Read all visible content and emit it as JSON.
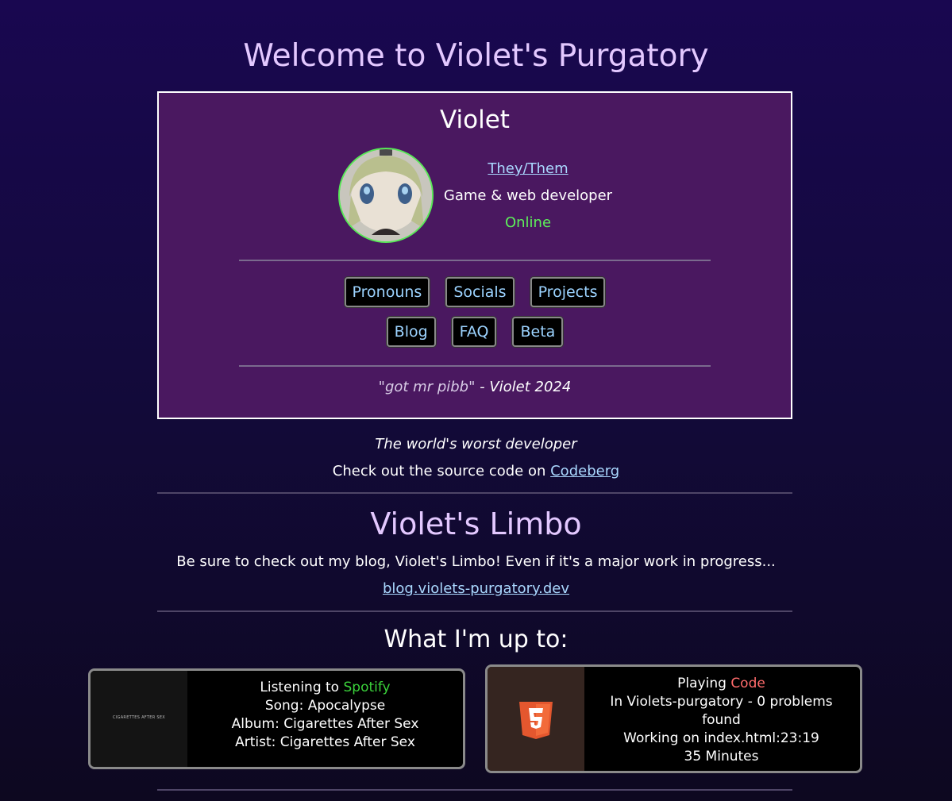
{
  "header": {
    "title": "Welcome to Violet's Purgatory"
  },
  "profile": {
    "name": "Violet",
    "pronouns": "They/Them",
    "role": "Game & web developer",
    "status": "Online",
    "nav_row1": [
      "Pronouns",
      "Socials",
      "Projects"
    ],
    "nav_row2": [
      "Blog",
      "FAQ",
      "Beta"
    ],
    "quote_text": "\"got mr pibb\"",
    "quote_author": " - Violet 2024"
  },
  "about": {
    "tagline": "The world's worst developer",
    "source_prefix": "Check out the source code on ",
    "source_link": "Codeberg"
  },
  "blog": {
    "title": "Violet's Limbo",
    "description": "Be sure to check out my blog, Violet's Limbo! Even if it's a major work in progress...",
    "link": "blog.violets-purgatory.dev"
  },
  "activity": {
    "title": "What I'm up to:",
    "spotify": {
      "prefix": "Listening to ",
      "app": "Spotify",
      "song": "Song: Apocalypse",
      "album": "Album: Cigarettes After Sex",
      "artist": "Artist: Cigarettes After Sex",
      "album_art_text": "CIGARETTES AFTER SEX"
    },
    "code": {
      "prefix": "Playing ",
      "app": "Code",
      "workspace": "In Violets-purgatory - 0 problems found",
      "file": "Working on index.html:23:19",
      "duration": "35 Minutes"
    }
  },
  "colors": {
    "accent": "#e3c8ff",
    "card_bg": "#4a1860",
    "status_online": "#5df05a",
    "link": "#aad8ff",
    "spotify": "#3ad13a",
    "code": "#ff6b6b"
  }
}
